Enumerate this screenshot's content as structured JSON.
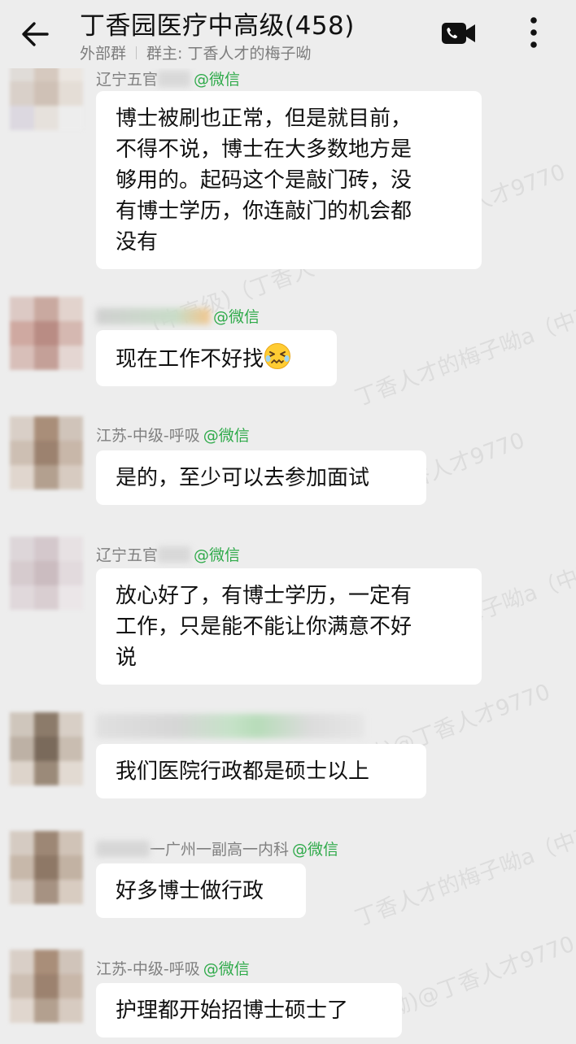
{
  "header": {
    "title": "丁香园医疗中高级(458)",
    "subtitle_left": "外部群",
    "subtitle_right": "群主: 丁香人才的梅子呦"
  },
  "watermark": {
    "a": "丁香人才9770",
    "b": "丁香人才的梅子呦a（中高级",
    "c": "丁香人才9770",
    "d": "(中高级)（丁香人",
    "e": "梅子呦a（中高级",
    "f": "梅子呦)@丁香人才9770",
    "g": "丁香人才的梅子呦a（中高级",
    "h": "梅子呦)@丁香人才9770"
  },
  "messages": [
    {
      "sender_visible": "辽宁五官",
      "wechat_tag": "@微信",
      "lines": [
        "博士被刷也正常，但是就目前，",
        "不得不说，博士在大多数地方是",
        "够用的。起码这个是敲门砖，没",
        "有博士学历，你连敲门的机会都",
        "没有"
      ]
    },
    {
      "sender_visible": "",
      "wechat_tag": "@微信",
      "lines": [
        "现在工作不好找"
      ],
      "emoji": "persevering-face"
    },
    {
      "sender_visible": "江苏-中级-呼吸",
      "wechat_tag": "@微信",
      "lines": [
        "是的，至少可以去参加面试"
      ]
    },
    {
      "sender_visible": "辽宁五官",
      "wechat_tag": "@微信",
      "lines": [
        "放心好了，有博士学历，一定有",
        "工作，只是能不能让你满意不好",
        "说"
      ]
    },
    {
      "sender_visible": "",
      "wechat_tag": "",
      "lines": [
        "我们医院行政都是硕士以上"
      ]
    },
    {
      "sender_visible": "一广州一副高一内科",
      "wechat_tag": "@微信",
      "lines": [
        "好多博士做行政"
      ]
    },
    {
      "sender_visible": "江苏-中级-呼吸",
      "wechat_tag": "@微信",
      "lines": [
        "护理都开始招博士硕士了"
      ]
    }
  ],
  "colors": {
    "background": "#ededed",
    "bubble": "#ffffff",
    "wechat_green": "#2faa4a",
    "sender_gray": "#808080"
  }
}
